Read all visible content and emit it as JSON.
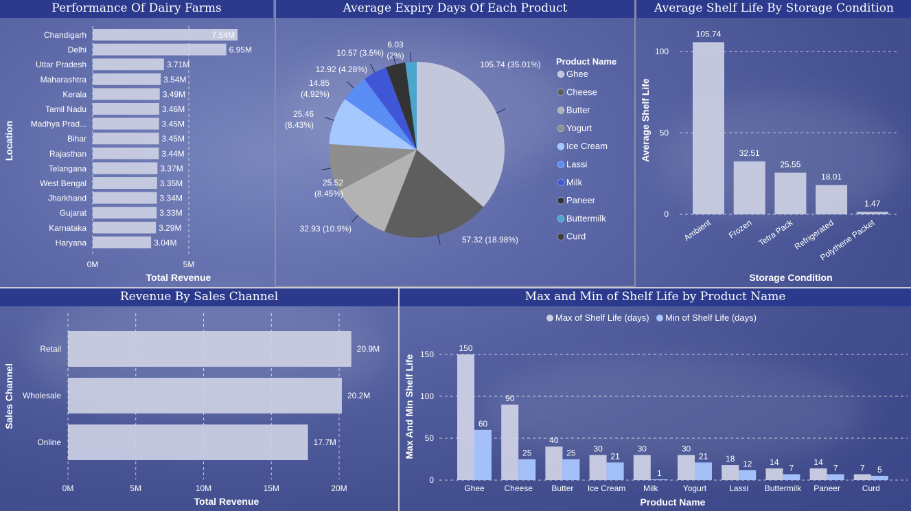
{
  "colors": {
    "bar": "#ccd0e4",
    "min_series": "#a9c6ff",
    "title_bg": "#2b3a8c"
  },
  "panels": {
    "dairy_title": "Performance Of Dairy Farms",
    "expiry_title": "Average Expiry Days Of Each Product",
    "shelf_title": "Average Shelf Life By Storage Condition",
    "channel_title": "Revenue By Sales Channel",
    "maxmin_title": "Max and Min of Shelf Life by Product Name"
  },
  "chart_data": [
    {
      "id": "dairy",
      "type": "bar",
      "orientation": "horizontal",
      "categories": [
        "Chandigarh",
        "Delhi",
        "Uttar Pradesh",
        "Maharashtra",
        "Kerala",
        "Tamil Nadu",
        "Madhya Prad...",
        "Bihar",
        "Rajasthan",
        "Telangana",
        "West Bengal",
        "Jharkhand",
        "Gujarat",
        "Karnataka",
        "Haryana"
      ],
      "values": [
        7.54,
        6.95,
        3.71,
        3.54,
        3.49,
        3.46,
        3.45,
        3.45,
        3.44,
        3.37,
        3.35,
        3.34,
        3.33,
        3.29,
        3.04
      ],
      "labels": [
        "7.54M",
        "6.95M",
        "3.71M",
        "3.54M",
        "3.49M",
        "3.46M",
        "3.45M",
        "3.45M",
        "3.44M",
        "3.37M",
        "3.35M",
        "3.34M",
        "3.33M",
        "3.29M",
        "3.04M"
      ],
      "xlabel": "Total Revenue",
      "ylabel": "Location",
      "xlim": [
        0,
        7.54
      ],
      "xticks": [
        0,
        5
      ],
      "xtick_labels": [
        "0M",
        "5M"
      ],
      "grid": true
    },
    {
      "id": "expiry",
      "type": "pie",
      "legend_title": "Product Name",
      "legend_position": "right",
      "slices": [
        {
          "name": "Ghee",
          "value": 105.74,
          "label": "105.74 (35.01%)",
          "color": "#c3c7db"
        },
        {
          "name": "Cheese",
          "value": 57.32,
          "label": "57.32 (18.98%)",
          "color": "#5e5e5e"
        },
        {
          "name": "Butter",
          "value": 32.93,
          "label": "32.93 (10.9%)",
          "color": "#b3b3b3"
        },
        {
          "name": "Yogurt",
          "value": 25.52,
          "label": "25.52 (8.45%)",
          "color": "#8e8e8e"
        },
        {
          "name": "Ice Cream",
          "value": 25.46,
          "label": "25.46 (8.43%)",
          "color": "#a5c8ff"
        },
        {
          "name": "Lassi",
          "value": 14.85,
          "label": "14.85 (4.92%)",
          "color": "#5b8ef5"
        },
        {
          "name": "Milk",
          "value": 12.92,
          "label": "12.92 (4.28%)",
          "color": "#3f56d6"
        },
        {
          "name": "Paneer",
          "value": 10.57,
          "label": "10.57 (3.5%)",
          "color": "#333333"
        },
        {
          "name": "Buttermilk",
          "value": 6.03,
          "label": "6.03 (2%)",
          "color": "#4aa6cc"
        },
        {
          "name": "Curd",
          "value": 0,
          "label": "",
          "color": "#3e3e3e"
        }
      ]
    },
    {
      "id": "shelf",
      "type": "bar",
      "categories": [
        "Ambient",
        "Frozen",
        "Tetra Pack",
        "Refrigerated",
        "Polythene Packet"
      ],
      "values": [
        105.74,
        32.51,
        25.55,
        18.01,
        1.47
      ],
      "labels": [
        "105.74",
        "32.51",
        "25.55",
        "18.01",
        "1.47"
      ],
      "xlabel": "Storage Condition",
      "ylabel": "Average Shelf Life",
      "ylim": [
        0,
        110
      ],
      "yticks": [
        0,
        50,
        100
      ],
      "grid": true
    },
    {
      "id": "channel",
      "type": "bar",
      "orientation": "horizontal",
      "categories": [
        "Retail",
        "Wholesale",
        "Online"
      ],
      "values": [
        20.9,
        20.2,
        17.7
      ],
      "labels": [
        "20.9M",
        "20.2M",
        "17.7M"
      ],
      "xlabel": "Total Revenue",
      "ylabel": "Sales Channel",
      "xlim": [
        0,
        22
      ],
      "xticks": [
        0,
        5,
        10,
        15,
        20
      ],
      "xtick_labels": [
        "0M",
        "5M",
        "10M",
        "15M",
        "20M"
      ],
      "grid": true
    },
    {
      "id": "maxmin",
      "type": "bar",
      "categories": [
        "Ghee",
        "Cheese",
        "Butter",
        "Ice Cream",
        "Milk",
        "Yogurt",
        "Lassi",
        "Buttermilk",
        "Paneer",
        "Curd"
      ],
      "series": [
        {
          "name": "Max of Shelf Life (days)",
          "values": [
            150,
            90,
            40,
            30,
            30,
            30,
            18,
            14,
            14,
            7
          ],
          "color": "#ccd0e4"
        },
        {
          "name": "Min of Shelf Life (days)",
          "values": [
            60,
            25,
            25,
            21,
            1,
            21,
            12,
            7,
            7,
            5
          ],
          "color": "#a9c6ff"
        }
      ],
      "xlabel": "Product Name",
      "ylabel": "Max And Min Shelf Life",
      "ylim": [
        0,
        160
      ],
      "yticks": [
        0,
        50,
        100,
        150
      ],
      "legend_position": "top",
      "grid": true
    }
  ]
}
